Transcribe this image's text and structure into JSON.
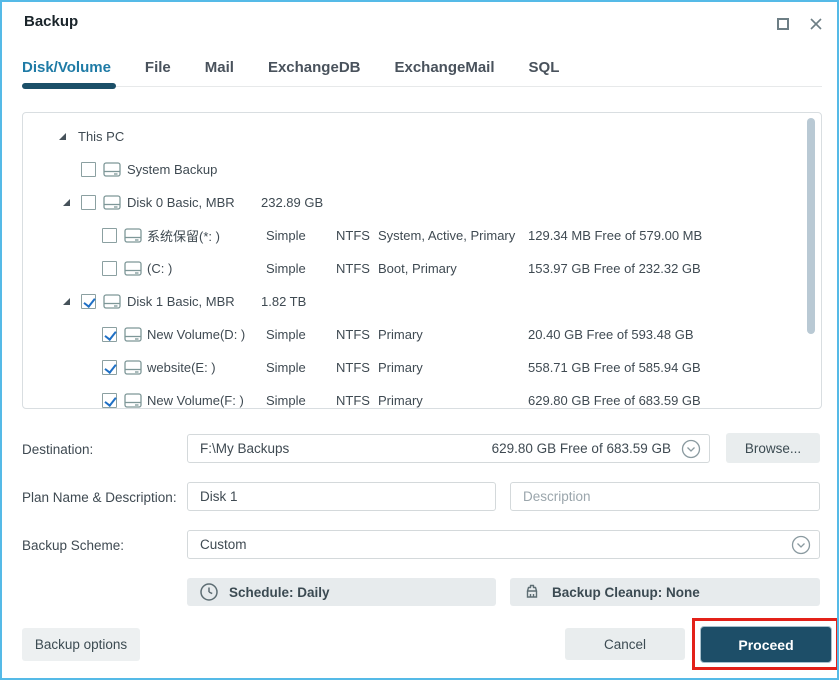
{
  "window": {
    "title": "Backup"
  },
  "titlebar": {
    "maximize_icon": "maximize",
    "close_icon": "close"
  },
  "tabs": {
    "items": [
      {
        "label": "Disk/Volume",
        "active": true
      },
      {
        "label": "File",
        "active": false
      },
      {
        "label": "Mail",
        "active": false
      },
      {
        "label": "ExchangeDB",
        "active": false
      },
      {
        "label": "ExchangeMail",
        "active": false
      },
      {
        "label": "SQL",
        "active": false
      }
    ]
  },
  "tree": {
    "rows": [
      {
        "label": "This PC",
        "level": 0,
        "expanded": true
      },
      {
        "label": "System Backup",
        "level": 1,
        "checked": false
      },
      {
        "label": "Disk 0 Basic, MBR",
        "size": "232.89 GB",
        "level": 1,
        "expanded": true,
        "checked": false
      },
      {
        "label": "系统保留(*: )",
        "type": "Simple",
        "fs": "NTFS",
        "attrs": "System, Active, Primary",
        "free": "129.34 MB Free of 579.00 MB",
        "level": 2,
        "checked": false
      },
      {
        "label": "(C: )",
        "type": "Simple",
        "fs": "NTFS",
        "attrs": "Boot, Primary",
        "free": "153.97 GB Free of 232.32 GB",
        "level": 2,
        "checked": false
      },
      {
        "label": "Disk 1 Basic, MBR",
        "size": "1.82 TB",
        "level": 1,
        "expanded": true,
        "checked": true
      },
      {
        "label": "New Volume(D: )",
        "type": "Simple",
        "fs": "NTFS",
        "attrs": "Primary",
        "free": "20.40 GB Free of 593.48 GB",
        "level": 2,
        "checked": true
      },
      {
        "label": "website(E: )",
        "type": "Simple",
        "fs": "NTFS",
        "attrs": "Primary",
        "free": "558.71 GB Free of 585.94 GB",
        "level": 2,
        "checked": true
      },
      {
        "label": "New Volume(F: )",
        "type": "Simple",
        "fs": "NTFS",
        "attrs": "Primary",
        "free": "629.80 GB Free of 683.59 GB",
        "level": 2,
        "checked": true
      }
    ]
  },
  "form": {
    "destination_label": "Destination:",
    "destination_value": "F:\\My Backups",
    "destination_free": "629.80 GB Free of 683.59 GB",
    "browse_label": "Browse...",
    "plan_label": "Plan Name & Description:",
    "plan_value": "Disk 1",
    "description_placeholder": "Description",
    "scheme_label": "Backup Scheme:",
    "scheme_value": "Custom",
    "schedule_label": "Schedule: Daily",
    "cleanup_label": "Backup Cleanup: None"
  },
  "footer": {
    "backup_options_label": "Backup options",
    "cancel_label": "Cancel",
    "proceed_label": "Proceed"
  },
  "colors": {
    "window_border": "#55bae7",
    "tab_active": "#1f7ba6",
    "tab_underline": "#1b4f68",
    "proceed_bg": "#1d4e68",
    "annotation_red": "#e32119",
    "checkbox_check": "#1f70c5"
  }
}
